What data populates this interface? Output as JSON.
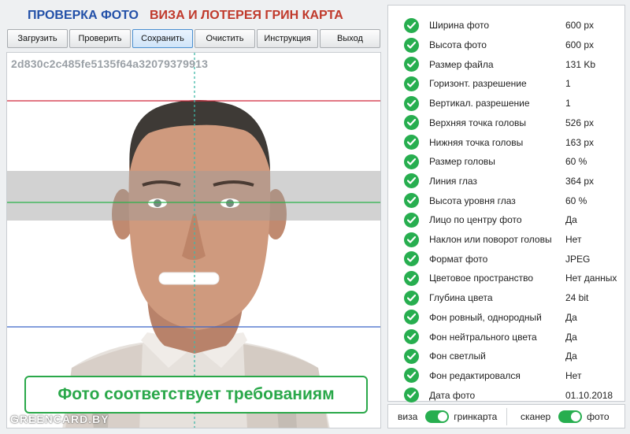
{
  "header": {
    "title_primary": "ПРОВЕРКА ФОТО",
    "title_secondary": "ВИЗА И ЛОТЕРЕЯ ГРИН КАРТА"
  },
  "toolbar": [
    {
      "label": "Загрузить"
    },
    {
      "label": "Проверить"
    },
    {
      "label": "Сохранить",
      "active": true
    },
    {
      "label": "Очистить"
    },
    {
      "label": "Инструкция"
    },
    {
      "label": "Выход"
    }
  ],
  "photo": {
    "hash": "2d830c2c485fe5135f64a32079379913",
    "status": "Фото соответствует требованиям",
    "watermark": "GREENCARD.BY"
  },
  "checks": [
    {
      "label": "Ширина фото",
      "value": "600 px"
    },
    {
      "label": "Высота фото",
      "value": "600 px"
    },
    {
      "label": "Размер файла",
      "value": "131 Kb"
    },
    {
      "label": "Горизонт. разрешение",
      "value": "1"
    },
    {
      "label": "Вертикал. разрешение",
      "value": "1"
    },
    {
      "label": "Верхняя точка головы",
      "value": "526 px"
    },
    {
      "label": "Нижняя точка головы",
      "value": "163 px"
    },
    {
      "label": "Размер головы",
      "value": "60 %"
    },
    {
      "label": "Линия глаз",
      "value": "364 px"
    },
    {
      "label": "Высота уровня глаз",
      "value": "60 %"
    },
    {
      "label": "Лицо по центру фото",
      "value": "Да"
    },
    {
      "label": "Наклон или поворот головы",
      "value": "Нет"
    },
    {
      "label": "Формат фото",
      "value": "JPEG"
    },
    {
      "label": "Цветовое пространство",
      "value": "Нет данных"
    },
    {
      "label": "Глубина цвета",
      "value": "24 bit"
    },
    {
      "label": "Фон ровный, однородный",
      "value": "Да"
    },
    {
      "label": "Фон нейтрального цвета",
      "value": "Да"
    },
    {
      "label": "Фон светлый",
      "value": "Да"
    },
    {
      "label": "Фон редактировался",
      "value": "Нет"
    },
    {
      "label": "Дата фото",
      "value": "01.10.2018"
    }
  ],
  "toggles": {
    "left": {
      "off_label": "виза",
      "on_label": "гринкарта",
      "on": true
    },
    "right": {
      "off_label": "сканер",
      "on_label": "фото",
      "on": true
    }
  },
  "colors": {
    "check": "#27ae4f",
    "title_blue": "#2250a8",
    "title_red": "#c0392b",
    "status_green": "#2aa84a"
  }
}
